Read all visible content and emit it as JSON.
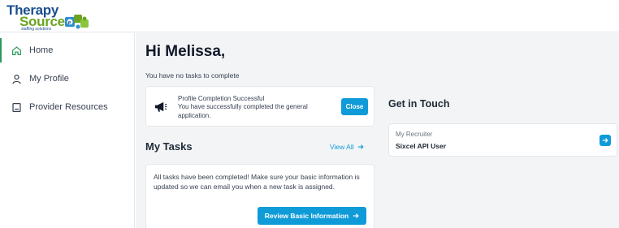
{
  "brand": {
    "line1": "Therapy",
    "line2": "Source",
    "tagline": "staffing solutions",
    "colors": {
      "blue": "#1b4f8f",
      "green": "#6aa421",
      "accent": "#0f9bd8",
      "active": "#2b9a5a"
    }
  },
  "sidebar": {
    "items": [
      {
        "label": "Home",
        "icon": "home-icon",
        "active": true
      },
      {
        "label": "My Profile",
        "icon": "user-icon",
        "active": false
      },
      {
        "label": "Provider Resources",
        "icon": "book-icon",
        "active": false
      }
    ]
  },
  "main": {
    "greeting": "Hi Melissa,",
    "no_tasks_text": "You have no tasks to complete",
    "profile_notice": {
      "title": "Profile Completion Successful",
      "description": "You have successfully completed the general application.",
      "close_label": "Close",
      "icon": "megaphone-icon"
    },
    "tasks": {
      "title": "My Tasks",
      "view_all_label": "View All",
      "message": "All tasks have been completed! Make sure your basic information is updated so we can email you when a new task is assigned.",
      "review_label": "Review Basic Information"
    },
    "contact": {
      "title": "Get in Touch",
      "recruiter_label": "My Recruiter",
      "recruiter_name": "Sixcel API User"
    }
  }
}
